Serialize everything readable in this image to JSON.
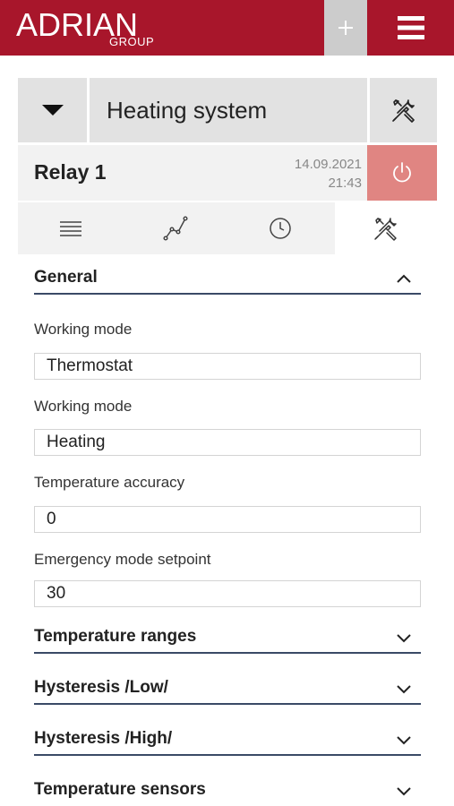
{
  "header": {
    "logo_main": "ADRIAN",
    "logo_sub": "GROUP",
    "plus_icon": "plus-icon",
    "menu_icon": "hamburger-menu-icon",
    "brand_color": "#a8162b"
  },
  "system": {
    "dropdown_icon": "caret-down-icon",
    "name": "Heating system",
    "tools_icon": "wrench-screwdriver-icon"
  },
  "relay": {
    "title": "Relay 1",
    "date": "14.09.2021",
    "time": "21:43",
    "power_icon": "power-icon",
    "power_color": "#e08582"
  },
  "tabs": [
    {
      "icon": "list-icon",
      "active": false
    },
    {
      "icon": "chart-line-icon",
      "active": false
    },
    {
      "icon": "clock-icon",
      "active": false
    },
    {
      "icon": "wrench-screwdriver-icon",
      "active": true
    }
  ],
  "sections": {
    "general": {
      "title": "General",
      "expanded": true,
      "fields": [
        {
          "label": "Working mode",
          "value": "Thermostat"
        },
        {
          "label": "Working mode",
          "value": "Heating"
        },
        {
          "label": "Temperature accuracy",
          "value": "0"
        },
        {
          "label": "Emergency mode setpoint",
          "value": "30"
        }
      ]
    },
    "temperature_ranges": {
      "title": "Temperature ranges",
      "expanded": false
    },
    "hysteresis_low": {
      "title": "Hysteresis /Low/",
      "expanded": false
    },
    "hysteresis_high": {
      "title": "Hysteresis /High/",
      "expanded": false
    },
    "temperature_sensors": {
      "title": "Temperature sensors",
      "expanded": false
    }
  }
}
